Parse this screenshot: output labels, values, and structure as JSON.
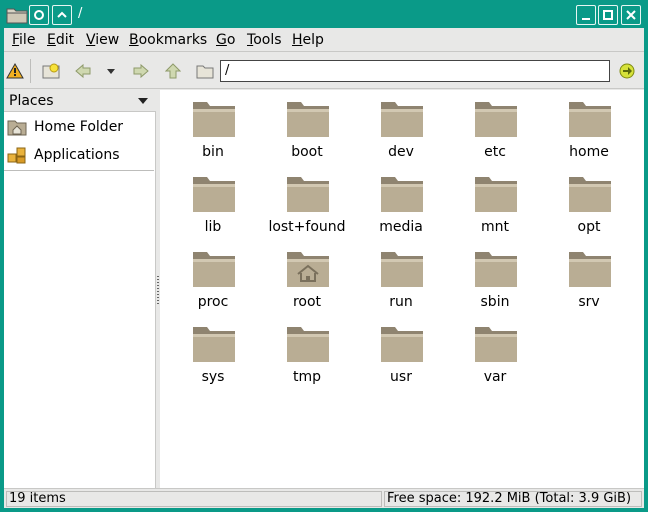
{
  "window": {
    "title": "/"
  },
  "menubar": [
    {
      "label": "File",
      "key": "F",
      "rest": "ile"
    },
    {
      "label": "Edit",
      "key": "E",
      "rest": "dit"
    },
    {
      "label": "View",
      "key": "V",
      "rest": "iew"
    },
    {
      "label": "Bookmarks",
      "key": "B",
      "rest": "ookmarks"
    },
    {
      "label": "Go",
      "key": "G",
      "rest": "o"
    },
    {
      "label": "Tools",
      "key": "T",
      "rest": "ools"
    },
    {
      "label": "Help",
      "key": "H",
      "rest": "elp"
    }
  ],
  "toolbar": {
    "location": "/"
  },
  "sidebar": {
    "heading": "Places",
    "items": [
      {
        "label": "Home Folder",
        "icon": "home-folder-icon"
      },
      {
        "label": "Applications",
        "icon": "applications-icon"
      }
    ]
  },
  "files": [
    {
      "name": "bin"
    },
    {
      "name": "boot"
    },
    {
      "name": "dev"
    },
    {
      "name": "etc"
    },
    {
      "name": "home"
    },
    {
      "name": "lib"
    },
    {
      "name": "lost+found"
    },
    {
      "name": "media"
    },
    {
      "name": "mnt"
    },
    {
      "name": "opt"
    },
    {
      "name": "proc"
    },
    {
      "name": "root"
    },
    {
      "name": "run"
    },
    {
      "name": "sbin"
    },
    {
      "name": "srv"
    },
    {
      "name": "sys"
    },
    {
      "name": "tmp"
    },
    {
      "name": "usr"
    },
    {
      "name": "var"
    }
  ],
  "status": {
    "items": "19 items",
    "free": "Free space: 192.2 MiB (Total: 3.9 GiB)"
  },
  "colors": {
    "frame": "#0a9a88",
    "folder": "#b9ad94",
    "folder_dark": "#8f8470"
  }
}
